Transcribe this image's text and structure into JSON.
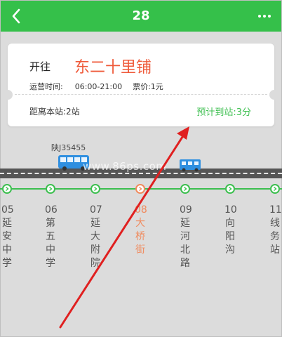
{
  "header": {
    "title": "28"
  },
  "card": {
    "direction_label": "开往",
    "destination": "东二十里铺",
    "hours_label": "运营时间:",
    "hours_value": "06:00-21:00",
    "fare": "票价:1元",
    "distance": "距离本站:2站",
    "eta": "预计到站:3分"
  },
  "bus": {
    "plate": "陕J35455"
  },
  "watermark": "www.86ps.com",
  "stops": [
    {
      "num": "05",
      "name": [
        "延",
        "安",
        "中",
        "学"
      ],
      "current": false
    },
    {
      "num": "06",
      "name": [
        "第",
        "五",
        "中",
        "学"
      ],
      "current": false
    },
    {
      "num": "07",
      "name": [
        "延",
        "大",
        "附",
        "院"
      ],
      "current": false
    },
    {
      "num": "08",
      "name": [
        "大",
        "桥",
        "街"
      ],
      "current": true
    },
    {
      "num": "09",
      "name": [
        "延",
        "河",
        "北",
        "路"
      ],
      "current": false
    },
    {
      "num": "10",
      "name": [
        "向",
        "阳",
        "沟"
      ],
      "current": false
    },
    {
      "num": "11",
      "name": [
        "线",
        "务",
        "站"
      ],
      "current": false
    }
  ],
  "colors": {
    "green": "#35c04a",
    "accent_red": "#ef5a3a",
    "current_orange": "#f08a5d",
    "annotation_red": "#e02020"
  },
  "icons": [
    "back-chevron-icon",
    "more-dots-icon",
    "bus-icon",
    "stop-arrow-icon"
  ]
}
